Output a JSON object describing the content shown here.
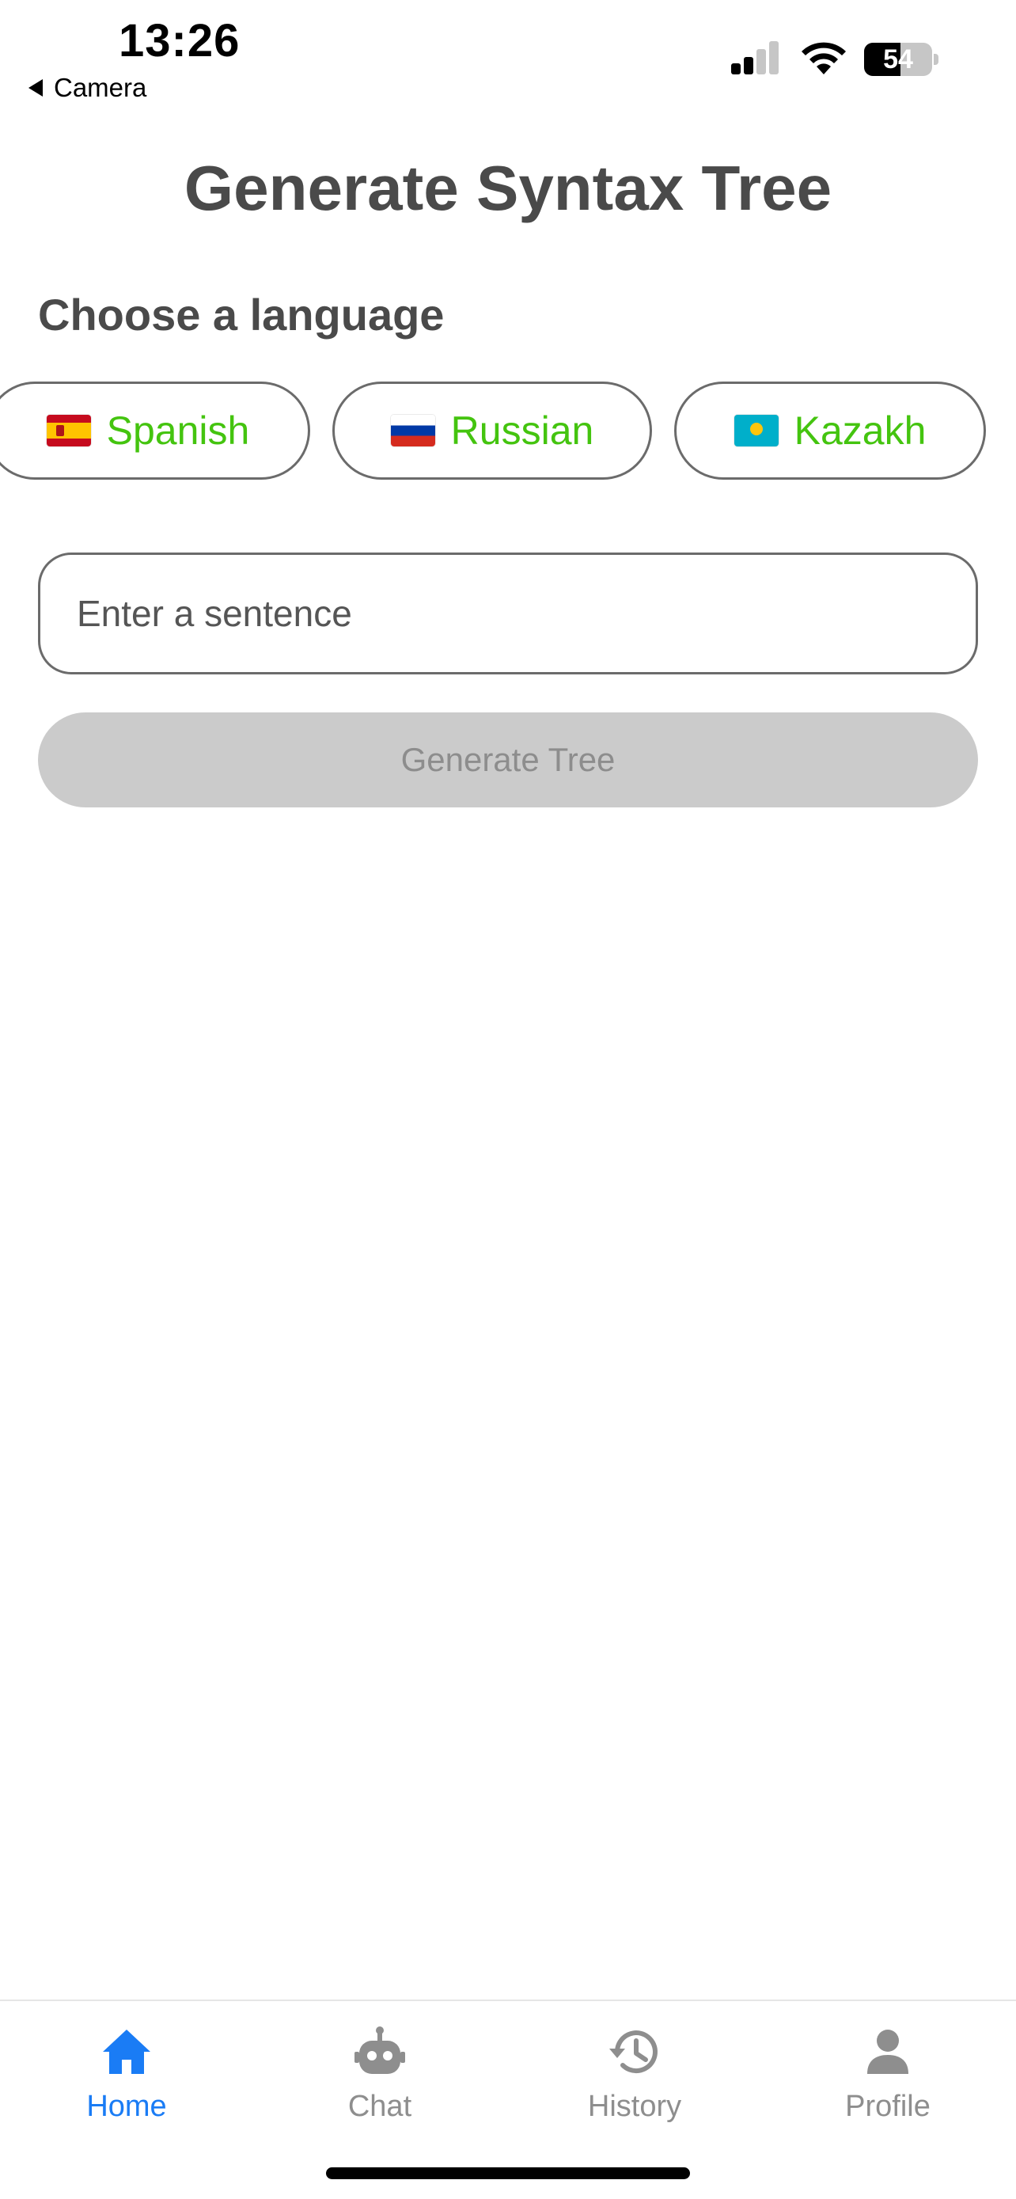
{
  "status_bar": {
    "time": "13:26",
    "back_app": "Camera",
    "battery_level": 54,
    "battery_text": "54"
  },
  "page": {
    "title": "Generate Syntax Tree",
    "section_label": "Choose a language"
  },
  "languages": [
    {
      "name": "Spanish",
      "flag": "spain-flag"
    },
    {
      "name": "Russian",
      "flag": "russia-flag"
    },
    {
      "name": "Kazakh",
      "flag": "kazakhstan-flag"
    }
  ],
  "sentence_input": {
    "value": "",
    "placeholder": "Enter a sentence"
  },
  "generate_button": {
    "label": "Generate Tree",
    "enabled": false
  },
  "tabs": [
    {
      "label": "Home",
      "icon": "home-icon",
      "active": true
    },
    {
      "label": "Chat",
      "icon": "robot-icon",
      "active": false
    },
    {
      "label": "History",
      "icon": "history-icon",
      "active": false
    },
    {
      "label": "Profile",
      "icon": "person-icon",
      "active": false
    }
  ],
  "colors": {
    "accent": "#1a7cf5",
    "language_text": "#44c40f",
    "disabled_button": "#cbcbcb",
    "inactive_tab": "#8e8e8e"
  }
}
